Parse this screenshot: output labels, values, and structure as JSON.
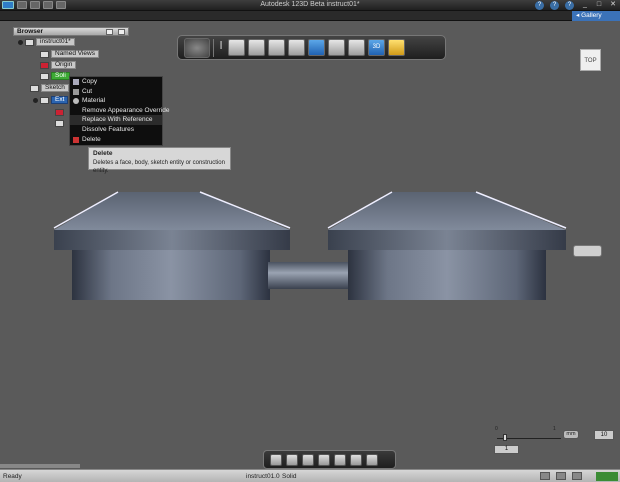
{
  "window": {
    "title": "Autodesk 123D Beta   instruct01*",
    "gallery_label": "Gallery",
    "help_icons": [
      "?",
      "?",
      "?"
    ],
    "controls": [
      "_",
      "□",
      "✕"
    ]
  },
  "browser": {
    "title": "Browser",
    "items": [
      {
        "label": "instruct01*"
      },
      {
        "label": "Named Views"
      },
      {
        "label": "Origin"
      },
      {
        "label": "Soli"
      },
      {
        "label": "Sketch"
      },
      {
        "label": "Ext"
      }
    ]
  },
  "context_menu": {
    "items": [
      {
        "label": "Copy"
      },
      {
        "label": "Cut"
      },
      {
        "label": "Material"
      },
      {
        "label": "Remove Appearance Override"
      },
      {
        "label": "Replace With Reference"
      },
      {
        "label": "Dissolve Features"
      },
      {
        "label": "Delete"
      }
    ]
  },
  "tooltip": {
    "title": "Delete",
    "description": "Deletes a face, body, sketch entity or construction entity."
  },
  "viewcube": {
    "label": "TOP"
  },
  "toolbar": {
    "buttons": [
      "home",
      "pencil",
      "box",
      "box-face",
      "move",
      "shell",
      "box-blue",
      "combine",
      "3d",
      "2d",
      "material-yellow"
    ],
    "labels": {
      "three_d": "3D"
    }
  },
  "slider": {
    "tick_left": "0",
    "tick_right": "1",
    "value": "1",
    "unit": "mm",
    "max": "10"
  },
  "navbar": {
    "buttons": [
      "orbit",
      "pan",
      "zoom",
      "fit",
      "look",
      "section",
      "visual-style"
    ]
  },
  "status": {
    "left": "Ready",
    "file": "instruct01.0",
    "mode": "Solid"
  },
  "colors": {
    "background": "#5a5a5a",
    "accent_blue": "#3b72b8",
    "highlight_green": "#3caa34"
  }
}
